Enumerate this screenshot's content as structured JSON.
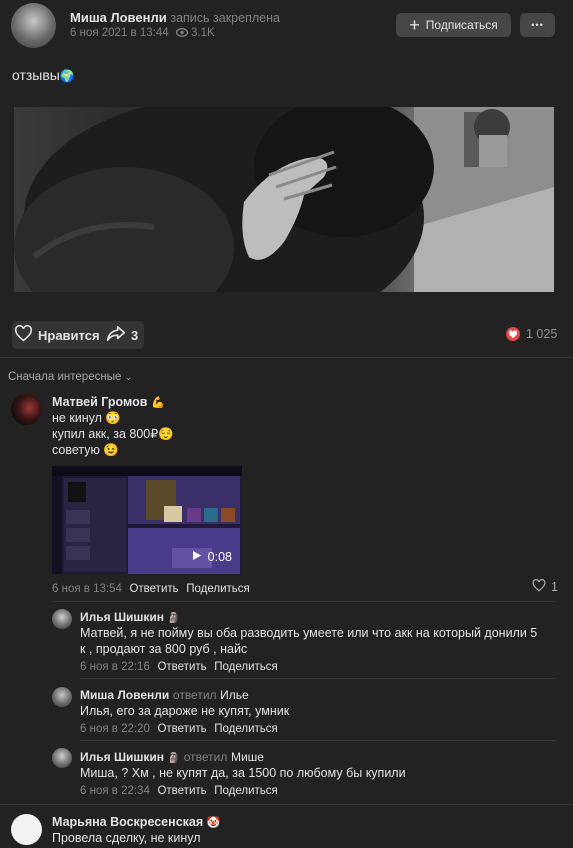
{
  "post": {
    "author": "Миша Ловенли",
    "pinned_label": "запись закреплена",
    "date": "6 ноя 2021 в 13:44",
    "views": "3.1K",
    "subscribe_label": "Подписаться",
    "more_label": "•••",
    "text": "отзывы",
    "text_emoji": "🌍"
  },
  "actions": {
    "like_label": "Нравится",
    "share_count": "3",
    "likes_count": "1 025"
  },
  "sort_label": "Сначала интересные",
  "comments": [
    {
      "author": "Матвей Громов",
      "author_emoji": "💪",
      "lines": [
        "не кинул 😳",
        "купил акк, за 800₽😌",
        "советую 😉"
      ],
      "video_duration": "0:08",
      "date": "6 ноя в 13:54",
      "reply_label": "Ответить",
      "share_label": "Поделиться",
      "likes": "1",
      "replies": [
        {
          "author": "Илья Шишкин",
          "author_emoji": "🗿",
          "replied_to_label": "",
          "replied_to": "",
          "text": "Матвей, я не пойму вы оба разводить умеете или что акк на который донили 5 к , продают за 800 руб , найс",
          "date": "6 ноя в 22:16",
          "reply_label": "Ответить",
          "share_label": "Поделиться"
        },
        {
          "author": "Миша Ловенли",
          "author_emoji": "",
          "replied_to_label": "ответил",
          "replied_to": "Илье",
          "text": "Илья, его за дароже не купят, умник",
          "date": "6 ноя в 22:20",
          "reply_label": "Ответить",
          "share_label": "Поделиться"
        },
        {
          "author": "Илья Шишкин",
          "author_emoji": "🗿",
          "replied_to_label": "ответил",
          "replied_to": "Мише",
          "text": "Миша, ? Хм , не купят да, за 1500 по любому бы купили",
          "date": "6 ноя в 22:34",
          "reply_label": "Ответить",
          "share_label": "Поделиться"
        }
      ]
    },
    {
      "author": "Марьяна Воскресенская",
      "author_emoji": "🤡",
      "text": "Провела сделку, не кинул"
    }
  ],
  "colors": {
    "background": "#222222",
    "heart": "#e64646",
    "button": "#454647",
    "muted": "#828282"
  }
}
